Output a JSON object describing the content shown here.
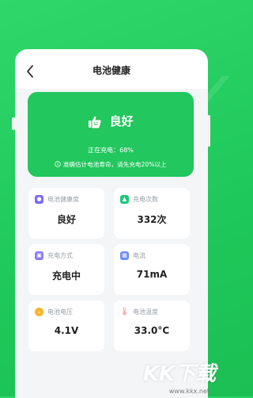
{
  "screen": {
    "title": "电池健康",
    "back_icon": "chevron-left-icon"
  },
  "hero": {
    "icon": "thumbs-up-icon",
    "status": "良好",
    "charging_line": "正在充电：68%",
    "tip_icon": "info-icon",
    "tip": "准确估计电池寿命，请先充电20%以上"
  },
  "cards": [
    {
      "icon": "battery-health-icon",
      "icon_color": "#7b6cf6",
      "label": "电池健康度",
      "value": "良好"
    },
    {
      "icon": "charge-count-icon",
      "icon_color": "#1fc77a",
      "label": "充电次数",
      "value": "332次"
    },
    {
      "icon": "charge-mode-icon",
      "icon_color": "#8a7cf7",
      "label": "充电方式",
      "value": "充电中"
    },
    {
      "icon": "current-icon",
      "icon_color": "#6c8cf8",
      "label": "电流",
      "value": "71mA"
    },
    {
      "icon": "voltage-icon",
      "icon_color": "#f5b62e",
      "label": "电池电压",
      "value": "4.1V"
    },
    {
      "icon": "temperature-icon",
      "icon_color": "#f28a8a",
      "label": "电池温度",
      "value": "33.0°C"
    }
  ],
  "watermark": {
    "brand": "KK下载",
    "url": "www.kkx.net"
  },
  "colors": {
    "brand_green": "#22c75d",
    "background_green": "#1fc85a"
  }
}
